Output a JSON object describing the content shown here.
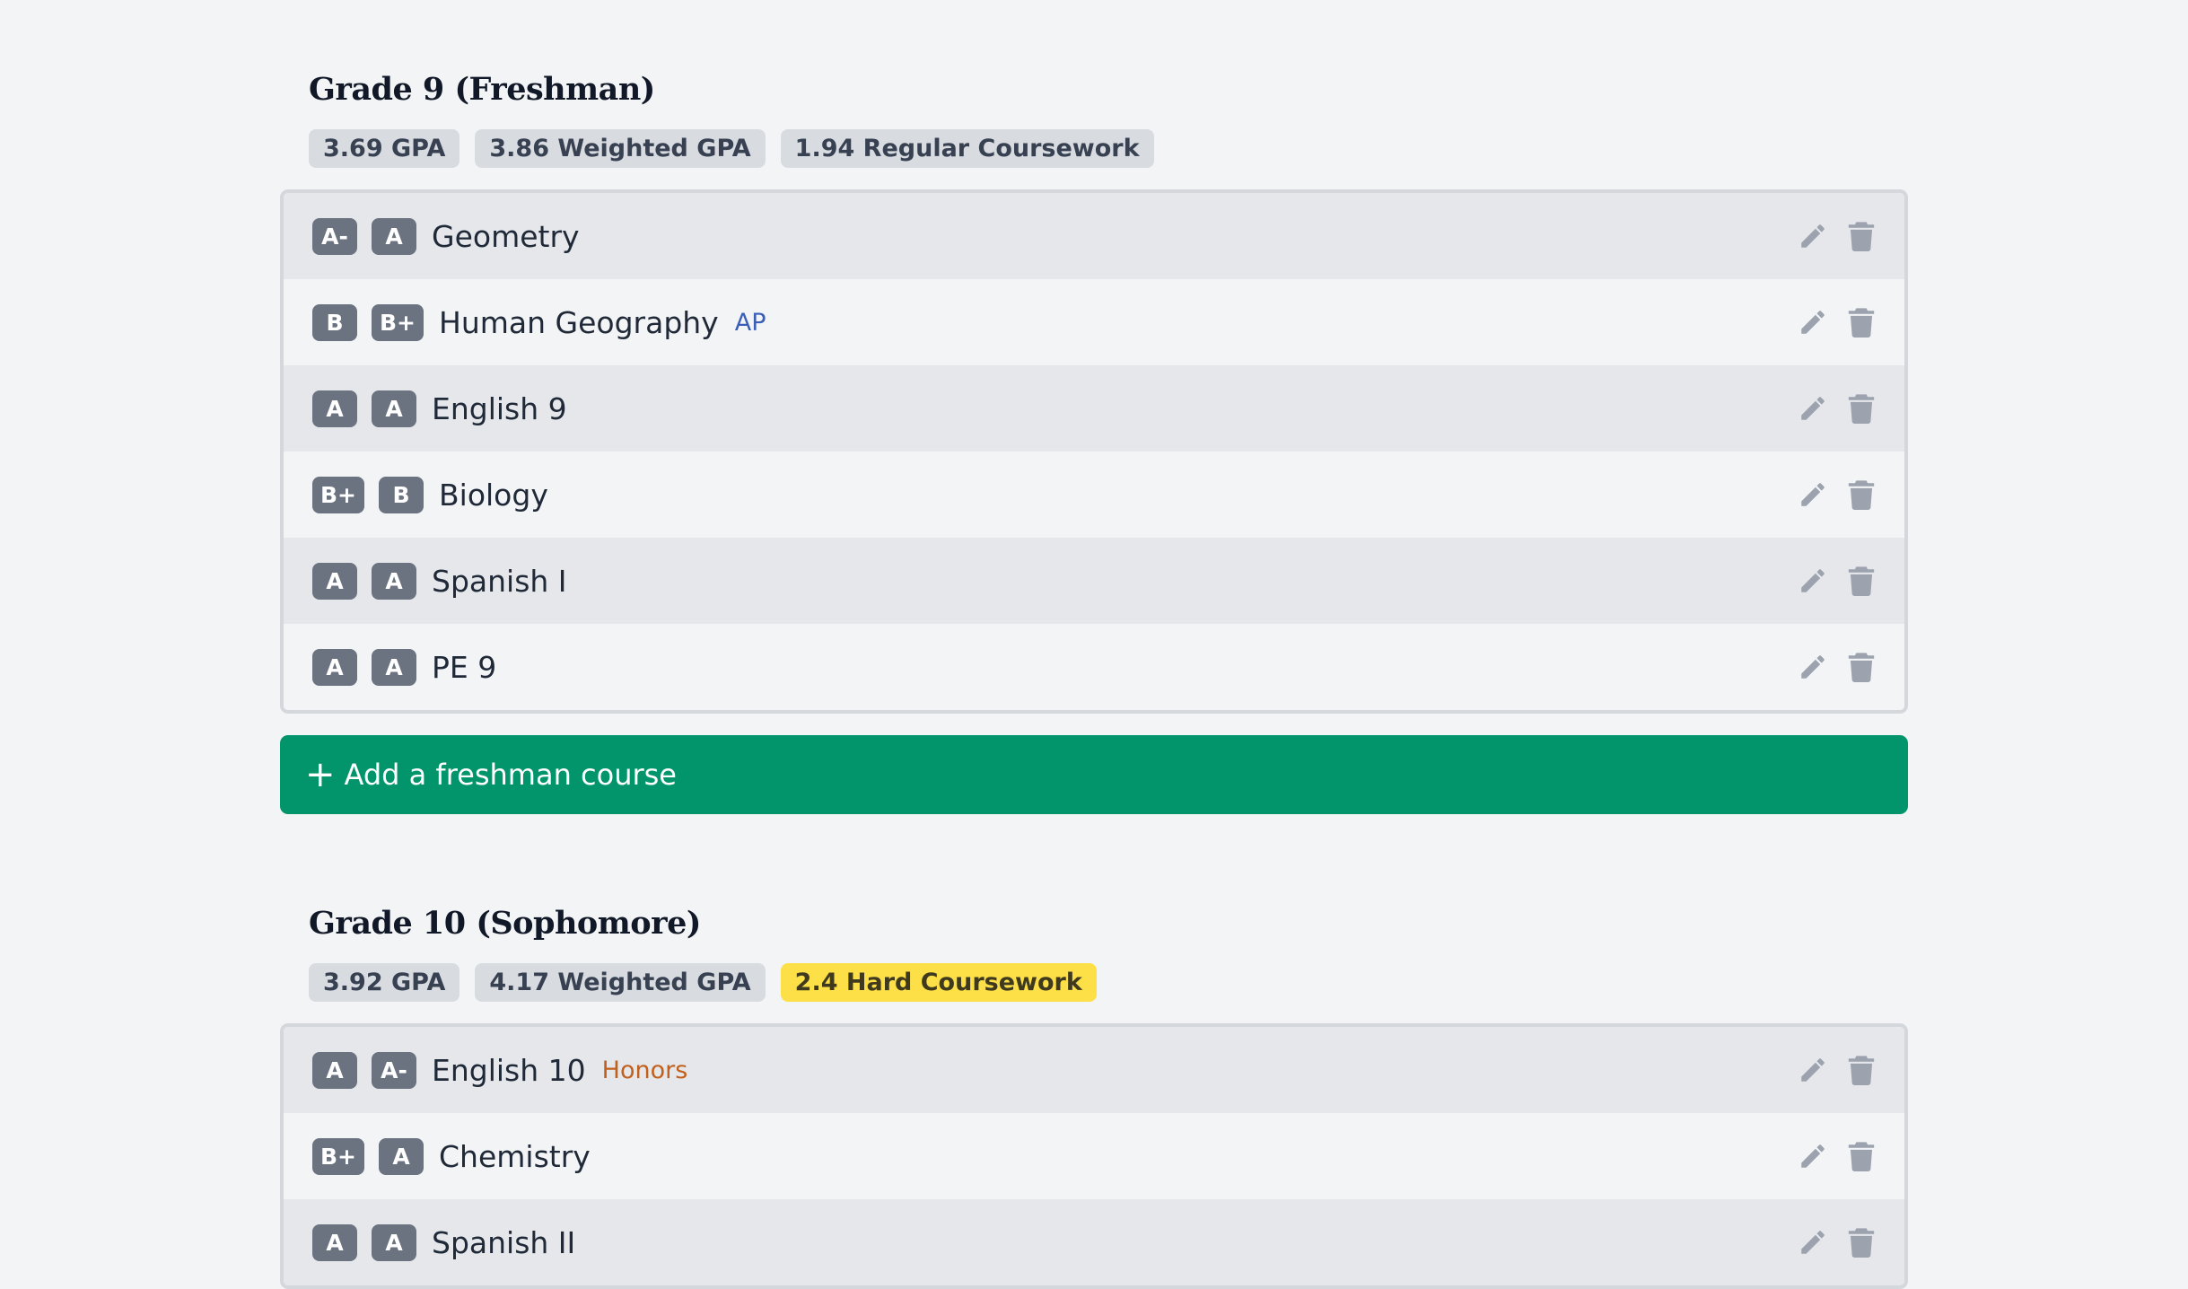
{
  "years": [
    {
      "title": "Grade 9 (Freshman)",
      "stats": [
        {
          "label": "3.69 GPA",
          "variant": "neutral"
        },
        {
          "label": "3.86 Weighted GPA",
          "variant": "neutral"
        },
        {
          "label": "1.94 Regular Coursework",
          "variant": "neutral"
        }
      ],
      "courses": [
        {
          "grade1": "A-",
          "grade2": "A",
          "name": "Geometry",
          "tag": ""
        },
        {
          "grade1": "B",
          "grade2": "B+",
          "name": "Human Geography",
          "tag": "AP"
        },
        {
          "grade1": "A",
          "grade2": "A",
          "name": "English 9",
          "tag": ""
        },
        {
          "grade1": "B+",
          "grade2": "B",
          "name": "Biology",
          "tag": ""
        },
        {
          "grade1": "A",
          "grade2": "A",
          "name": "Spanish I",
          "tag": ""
        },
        {
          "grade1": "A",
          "grade2": "A",
          "name": "PE 9",
          "tag": ""
        }
      ],
      "add_label": "Add a freshman course"
    },
    {
      "title": "Grade 10 (Sophomore)",
      "stats": [
        {
          "label": "3.92 GPA",
          "variant": "neutral"
        },
        {
          "label": "4.17 Weighted GPA",
          "variant": "neutral"
        },
        {
          "label": "2.4 Hard Coursework",
          "variant": "hard"
        }
      ],
      "courses": [
        {
          "grade1": "A",
          "grade2": "A-",
          "name": "English 10",
          "tag": "Honors"
        },
        {
          "grade1": "B+",
          "grade2": "A",
          "name": "Chemistry",
          "tag": ""
        },
        {
          "grade1": "A",
          "grade2": "A",
          "name": "Spanish II",
          "tag": ""
        }
      ]
    }
  ],
  "icons": {
    "edit": "pencil-icon",
    "delete": "trash-icon",
    "add": "plus-icon"
  },
  "colors": {
    "add_button": "#02956b",
    "grade_badge": "#6b7280",
    "hard_badge": "#fde047",
    "ap_tag": "#3b5eb8",
    "honors_tag": "#c2611d"
  }
}
